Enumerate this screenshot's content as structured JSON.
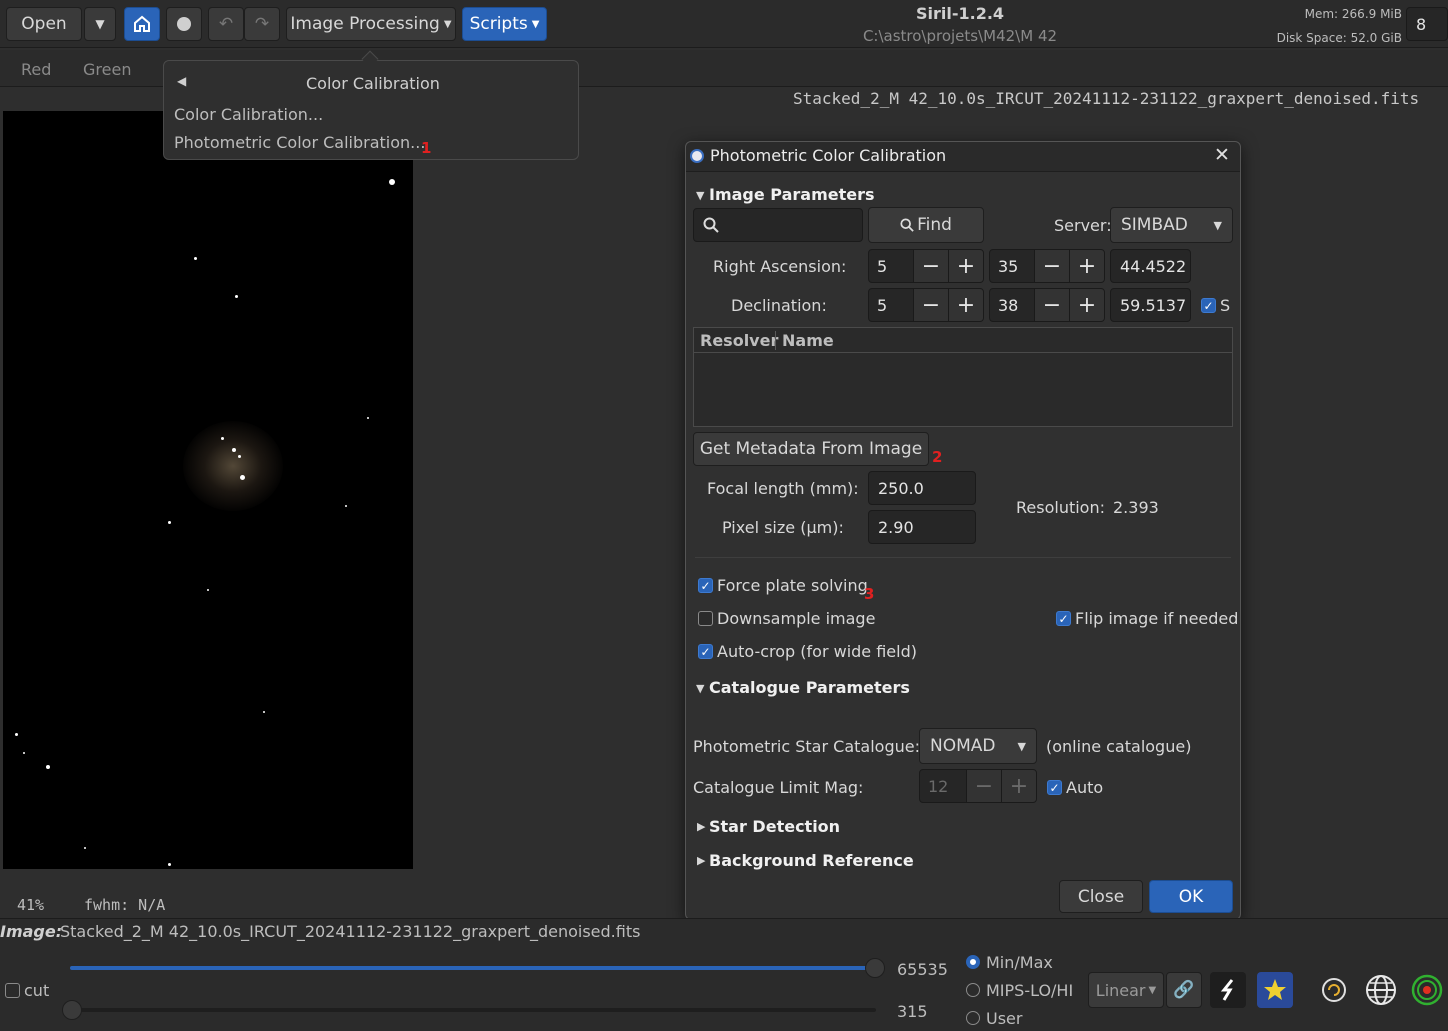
{
  "toolbar": {
    "open_label": "Open",
    "image_processing_label": "Image Processing",
    "scripts_label": "Scripts",
    "app_title": "Siril-1.2.4",
    "app_path": "C:\\astro\\projets\\M42\\M 42",
    "mem": "Mem: 266.9 MiB",
    "disk": "Disk Space: 52.0 GiB",
    "threads": "8"
  },
  "channel_tabs": [
    "Red",
    "Green"
  ],
  "filename_header": "Stacked_2_M 42_10.0s_IRCUT_20241112-231122_graxpert_denoised.fits",
  "menu": {
    "title": "Color Calibration",
    "items": [
      "Color Calibration...",
      "Photometric Color Calibration..."
    ],
    "marker": "1"
  },
  "dialog": {
    "title": "Photometric Color Calibration",
    "image_params_header": "Image Parameters",
    "search_placeholder": "",
    "find_label": "Find",
    "server_label": "Server:",
    "server_value": "SIMBAD",
    "ra_label": "Right Ascension:",
    "ra": [
      "5",
      "35",
      "44.4522"
    ],
    "dec_label": "Declination:",
    "dec": [
      "5",
      "38",
      "59.5137"
    ],
    "s_label": "S",
    "table_headers": [
      "Resolver",
      "Name"
    ],
    "get_metadata_label": "Get Metadata From Image",
    "marker2": "2",
    "focal_label": "Focal length (mm):",
    "focal_value": "250.0",
    "pixel_label": "Pixel size (µm):",
    "pixel_value": "2.90",
    "resolution_label": "Resolution:",
    "resolution_value": "2.393",
    "force_plate_label": "Force plate solving",
    "marker3": "3",
    "downsample_label": "Downsample image",
    "flip_label": "Flip image if needed",
    "autocrop_label": "Auto-crop (for wide field)",
    "catalogue_header": "Catalogue Parameters",
    "star_catalogue_label": "Photometric Star Catalogue:",
    "star_catalogue_value": "NOMAD",
    "online_note": "(online catalogue)",
    "limit_mag_label": "Catalogue Limit Mag:",
    "limit_mag_value": "12",
    "auto_label": "Auto",
    "star_detection_header": "Star Detection",
    "background_header": "Background Reference",
    "close_label": "Close",
    "ok_label": "OK"
  },
  "status": {
    "zoom": "41%",
    "fwhm": "fwhm: N/A",
    "image_prefix": "Image:",
    "image_name": "Stacked_2_M 42_10.0s_IRCUT_20241112-231122_graxpert_denoised.fits"
  },
  "bottom": {
    "cut_label": "cut",
    "max_value": "65535",
    "min_value": "315",
    "radio_minmax": "Min/Max",
    "radio_mips": "MIPS-LO/HI",
    "radio_user": "User",
    "scale_value": "Linear"
  },
  "colors": {
    "accent": "#2a64b8",
    "marker": "#e02020"
  }
}
